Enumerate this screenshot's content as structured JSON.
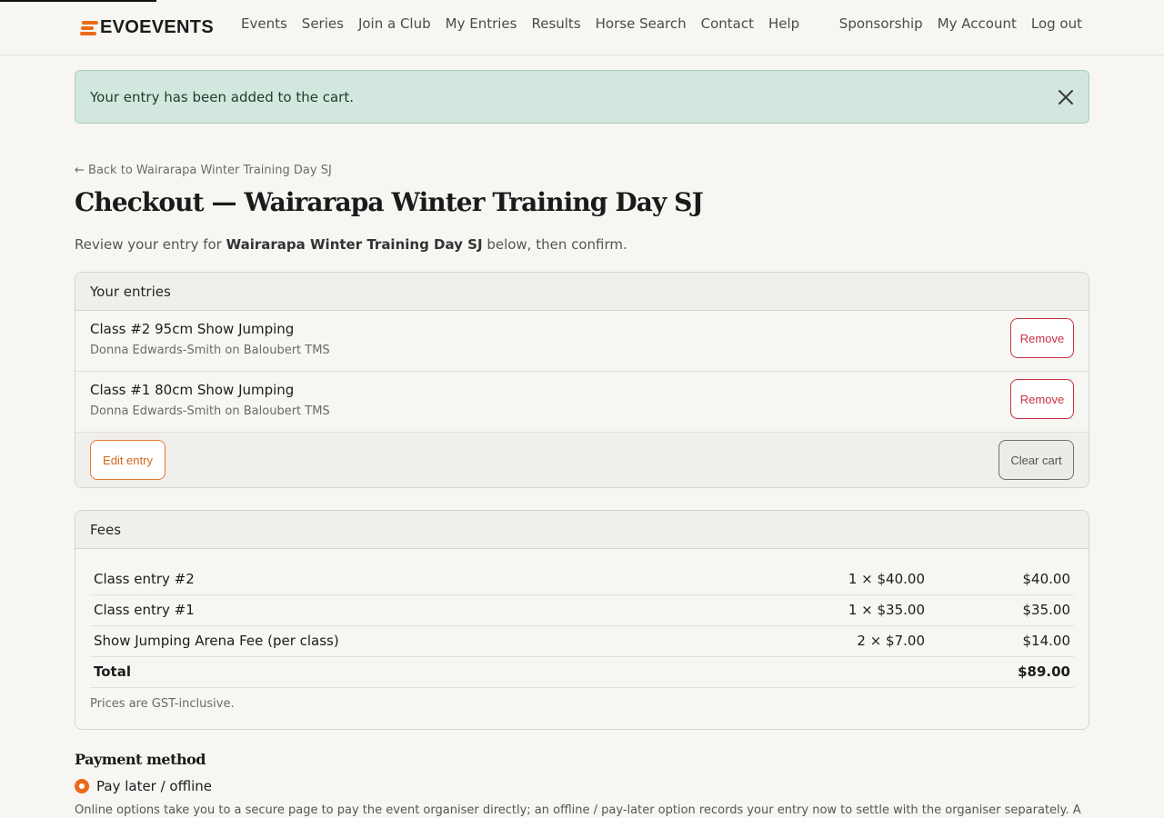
{
  "brand": {
    "name": "EVOEVENTS"
  },
  "nav": {
    "left": [
      "Events",
      "Series",
      "Join a Club",
      "My Entries",
      "Results",
      "Horse Search",
      "Contact",
      "Help"
    ],
    "right": [
      "Sponsorship",
      "My Account",
      "Log out"
    ]
  },
  "alert": {
    "message": "Your entry has been added to the cart."
  },
  "back_link": "← Back to Wairarapa Winter Training Day SJ",
  "page_title": "Checkout — Wairarapa Winter Training Day SJ",
  "intro": {
    "prefix": "Review your entry for ",
    "event": "Wairarapa Winter Training Day SJ",
    "suffix": " below, then confirm."
  },
  "entries": {
    "header": "Your entries",
    "items": [
      {
        "title": "Class #2 95cm Show Jumping",
        "rider": "Donna Edwards-Smith on Baloubert TMS",
        "remove_label": "Remove"
      },
      {
        "title": "Class #1 80cm Show Jumping",
        "rider": "Donna Edwards-Smith on Baloubert TMS",
        "remove_label": "Remove"
      }
    ],
    "edit_label": "Edit entry",
    "clear_label": "Clear cart"
  },
  "fees": {
    "header": "Fees",
    "rows": [
      {
        "label": "Class entry #2",
        "qty": "1 × $40.00",
        "amount": "$40.00"
      },
      {
        "label": "Class entry #1",
        "qty": "1 × $35.00",
        "amount": "$35.00"
      },
      {
        "label": "Show Jumping Arena Fee (per class)",
        "qty": "2 × $7.00",
        "amount": "$14.00"
      }
    ],
    "total_label": "Total",
    "total_amount": "$89.00",
    "note": "Prices are GST-inclusive."
  },
  "payment": {
    "title": "Payment method",
    "option_label": "Pay later / offline",
    "note": "Online options take you to a secure page to pay the event organiser directly; an offline / pay-later option records your entry now to settle with the organiser separately. A"
  },
  "colors": {
    "accent": "#ea6b17",
    "danger": "#c8303f",
    "success_bg": "#d2e7dd"
  }
}
